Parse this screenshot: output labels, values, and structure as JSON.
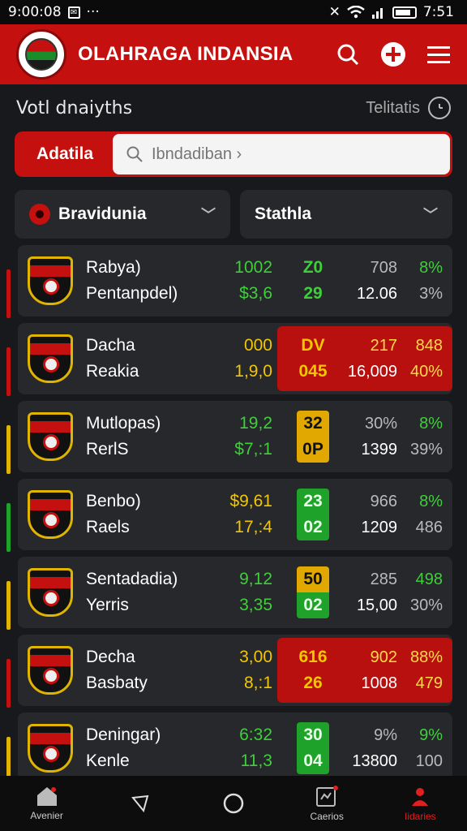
{
  "status_bar": {
    "time": "9:00:08",
    "extra": "···",
    "clock_right": "7:51"
  },
  "app": {
    "title": "OLAHRAGA INDANSIA"
  },
  "subheader": {
    "title": "Votl dnaiyths",
    "right_label": "Telitatis"
  },
  "search": {
    "label": "Adatila",
    "placeholder": "Ibndadiban ›"
  },
  "filters": [
    {
      "label": "Bravidunia"
    },
    {
      "label": "Stathla"
    }
  ],
  "rows": [
    {
      "team1": "Rabya)",
      "team2": "Pentanpdel)",
      "num1": "1002",
      "num2": "$3,6",
      "score1": "Z0",
      "score2": "29",
      "stat1": "708",
      "stat2": "8%",
      "stat3": "12.06",
      "stat4": "3%",
      "accent": "#c4100f",
      "highlight": false,
      "score_style": "plain-green"
    },
    {
      "team1": "Dacha",
      "team2": "Reakia",
      "num1": "000",
      "num2": "1,9,0",
      "score1": "DV",
      "score2": "045",
      "stat1": "217",
      "stat2": "848",
      "stat3": "16,009",
      "stat4": "40%",
      "accent": "#c4100f",
      "highlight": true,
      "score_style": "plain-yellow"
    },
    {
      "team1": "Mutlopas)",
      "team2": "RerlS",
      "num1": "19,2",
      "num2": "$7,:1",
      "score1": "32",
      "score2": "0P",
      "stat1": "30%",
      "stat2": "8%",
      "stat3": "1399",
      "stat4": "39%",
      "accent": "#e0b400",
      "highlight": false,
      "score_style": "box-yellow"
    },
    {
      "team1": "Benbo)",
      "team2": "Raels",
      "num1": "$9,61",
      "num2": "17,:4",
      "score1": "23",
      "score2": "02",
      "stat1": "966",
      "stat2": "8%",
      "stat3": "1209",
      "stat4": "486",
      "accent": "#1fa22a",
      "highlight": false,
      "score_style": "box-green"
    },
    {
      "team1": "Sentadadia)",
      "team2": "Yerris",
      "num1": "9,12",
      "num2": "3,35",
      "score1": "50",
      "score2": "02",
      "stat1": "285",
      "stat2": "498",
      "stat3": "15,00",
      "stat4": "30%",
      "accent": "#e0b400",
      "highlight": false,
      "score_style": "box-mixed"
    },
    {
      "team1": "Decha",
      "team2": "Basbaty",
      "num1": "3,00",
      "num2": "8,:1",
      "score1": "616",
      "score2": "26",
      "stat1": "902",
      "stat2": "88%",
      "stat3": "1008",
      "stat4": "479",
      "accent": "#c4100f",
      "highlight": true,
      "score_style": "plain-yellow"
    },
    {
      "team1": "Deningar)",
      "team2": "Kenle",
      "num1": "6:32",
      "num2": "11,3",
      "score1": "30",
      "score2": "04",
      "stat1": "9%",
      "stat2": "9%",
      "stat3": "13800",
      "stat4": "100",
      "accent": "#e0b400",
      "highlight": false,
      "score_style": "box-green"
    }
  ],
  "bottom_nav": [
    {
      "label": "Avenier",
      "icon": "home-icon"
    },
    {
      "label": "",
      "icon": "back-icon"
    },
    {
      "label": "",
      "icon": "home-circle-icon"
    },
    {
      "label": "Caerios",
      "icon": "calendar-icon"
    },
    {
      "label": "Iidaries",
      "icon": "profile-icon",
      "active": true
    }
  ],
  "colors": {
    "brand_red": "#c4100f",
    "green": "#1fa22a",
    "yellow": "#e0b400",
    "bg": "#18191c",
    "card": "#26282c"
  }
}
